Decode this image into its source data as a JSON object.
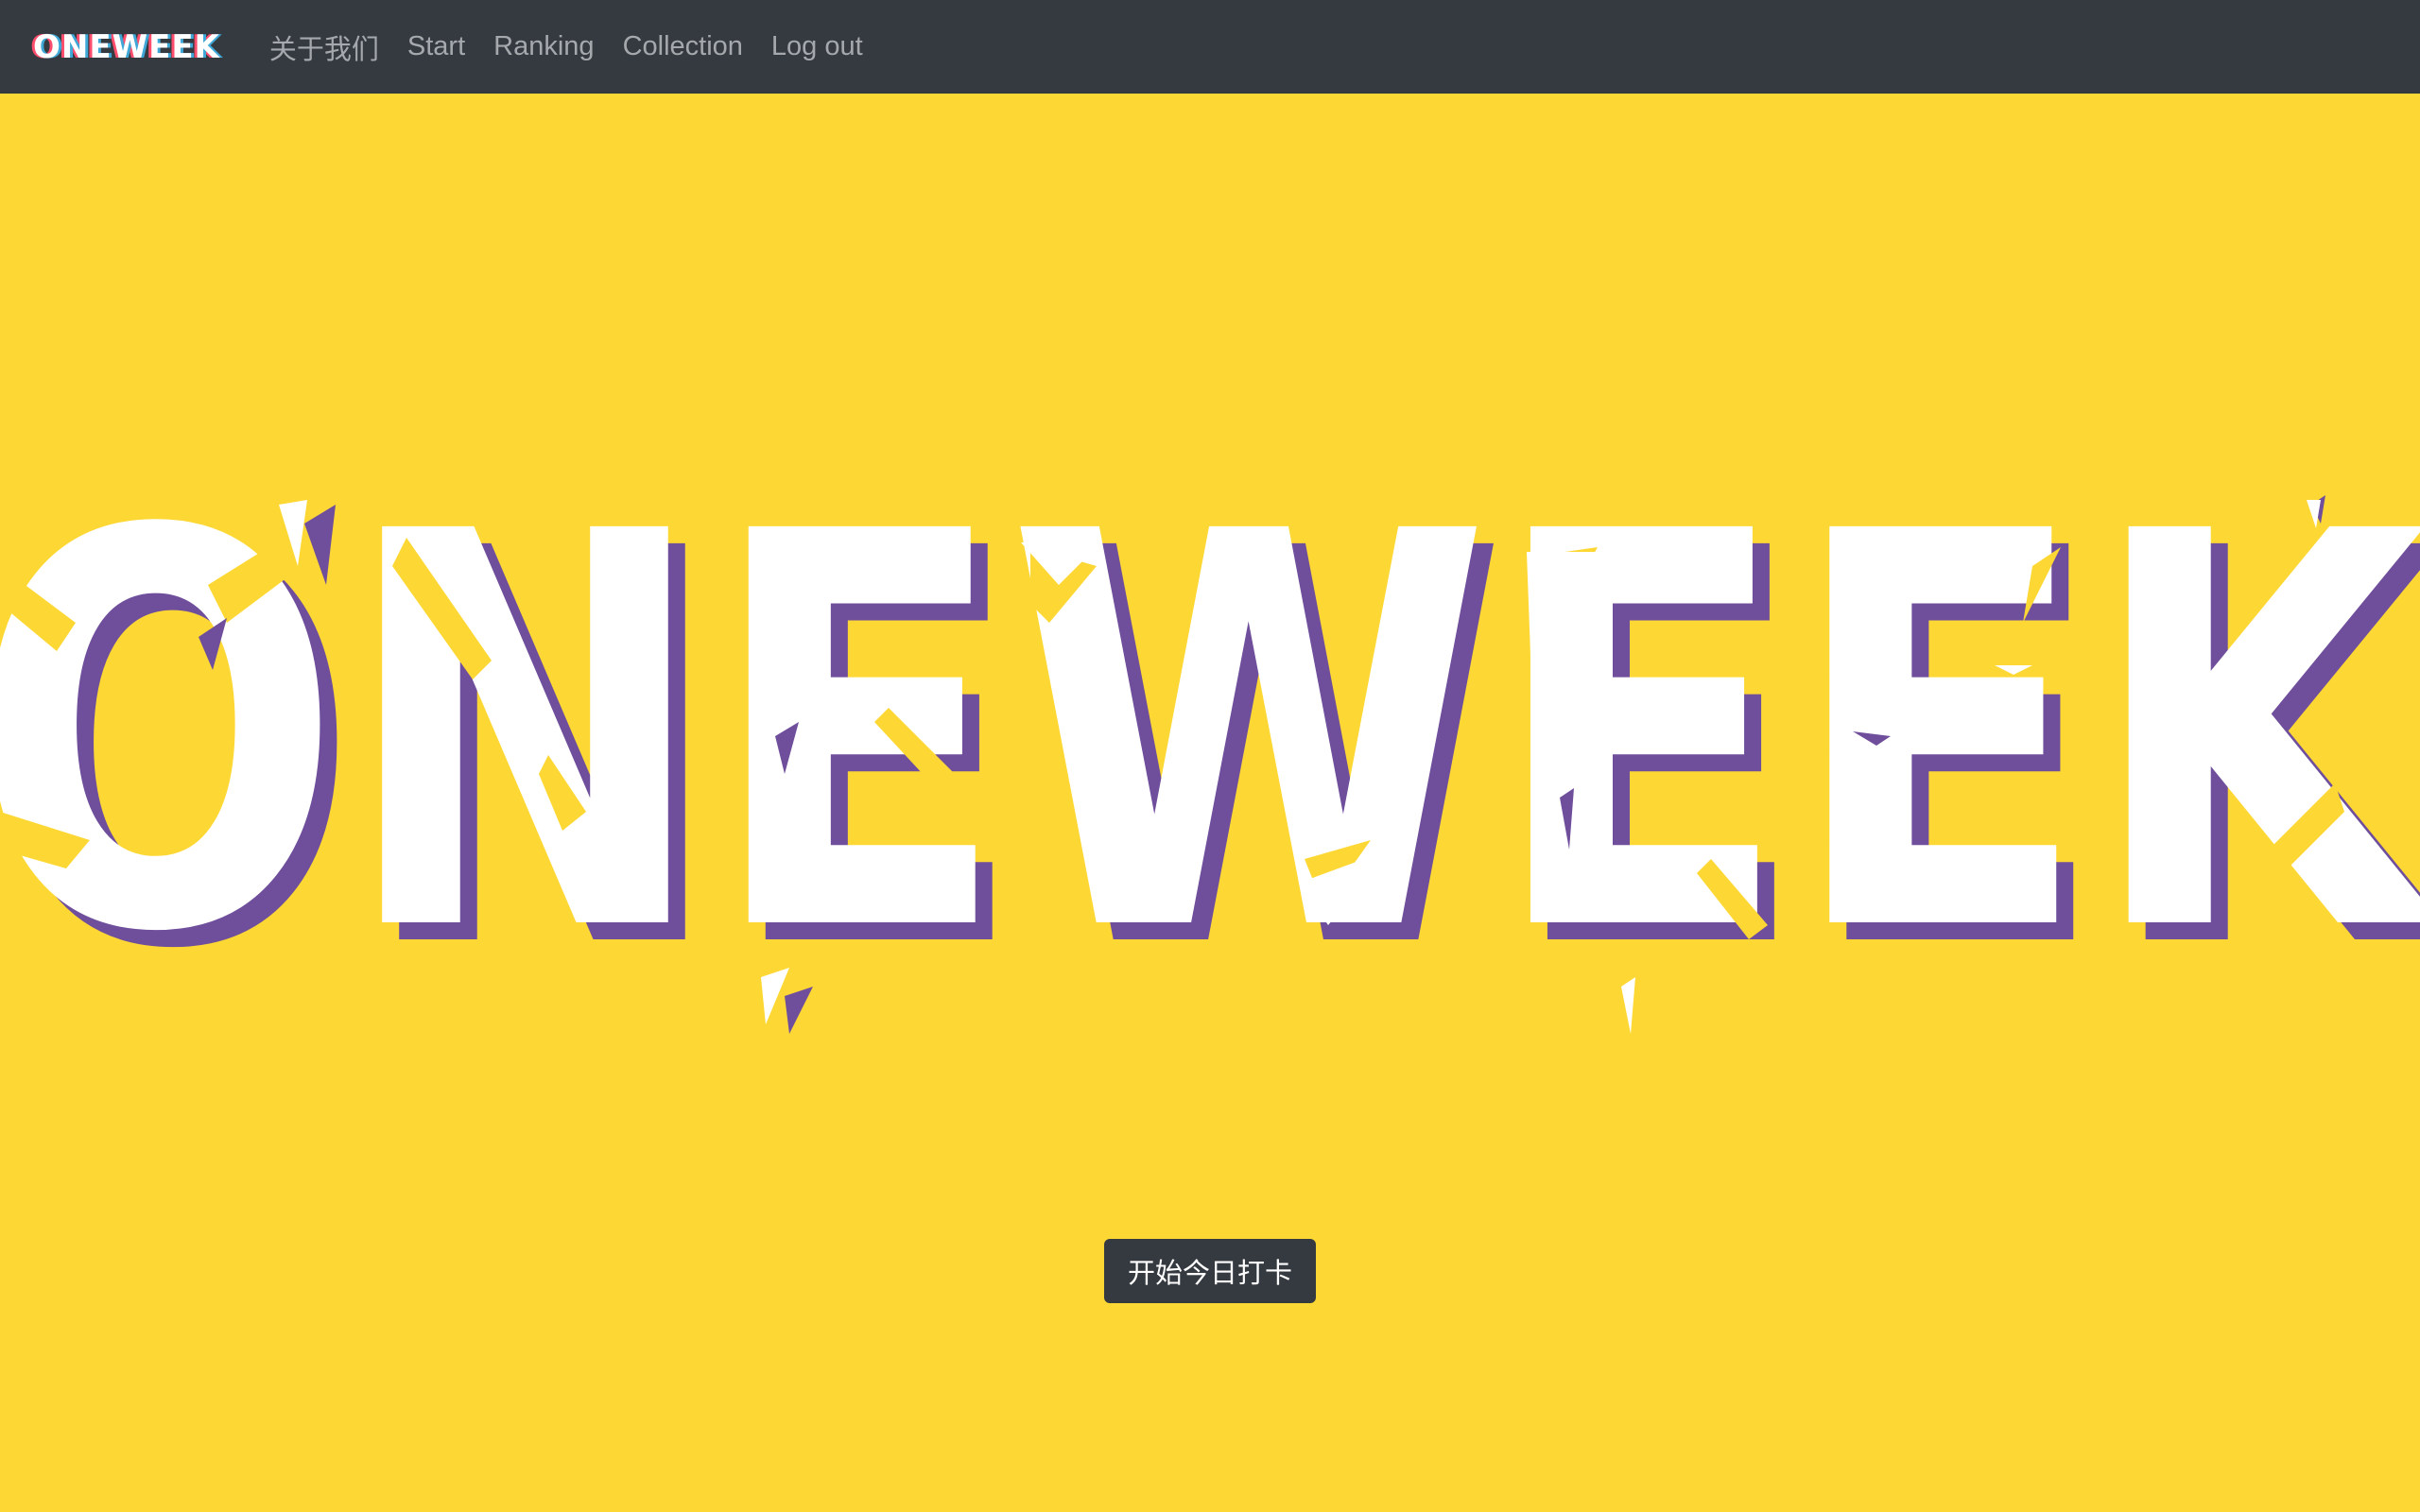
{
  "navbar": {
    "brand": "ONEWEEK",
    "links": [
      {
        "label": "关于我们"
      },
      {
        "label": "Start"
      },
      {
        "label": "Ranking"
      },
      {
        "label": "Collection"
      },
      {
        "label": "Log out"
      }
    ]
  },
  "hero": {
    "title": "ONEWEEK",
    "cta_label": "开始今日打卡"
  },
  "colors": {
    "background": "#fdd835",
    "navbar": "#343a40",
    "title_fill": "#ffffff",
    "title_shadow": "#6f4e9b",
    "button": "#343a40"
  }
}
